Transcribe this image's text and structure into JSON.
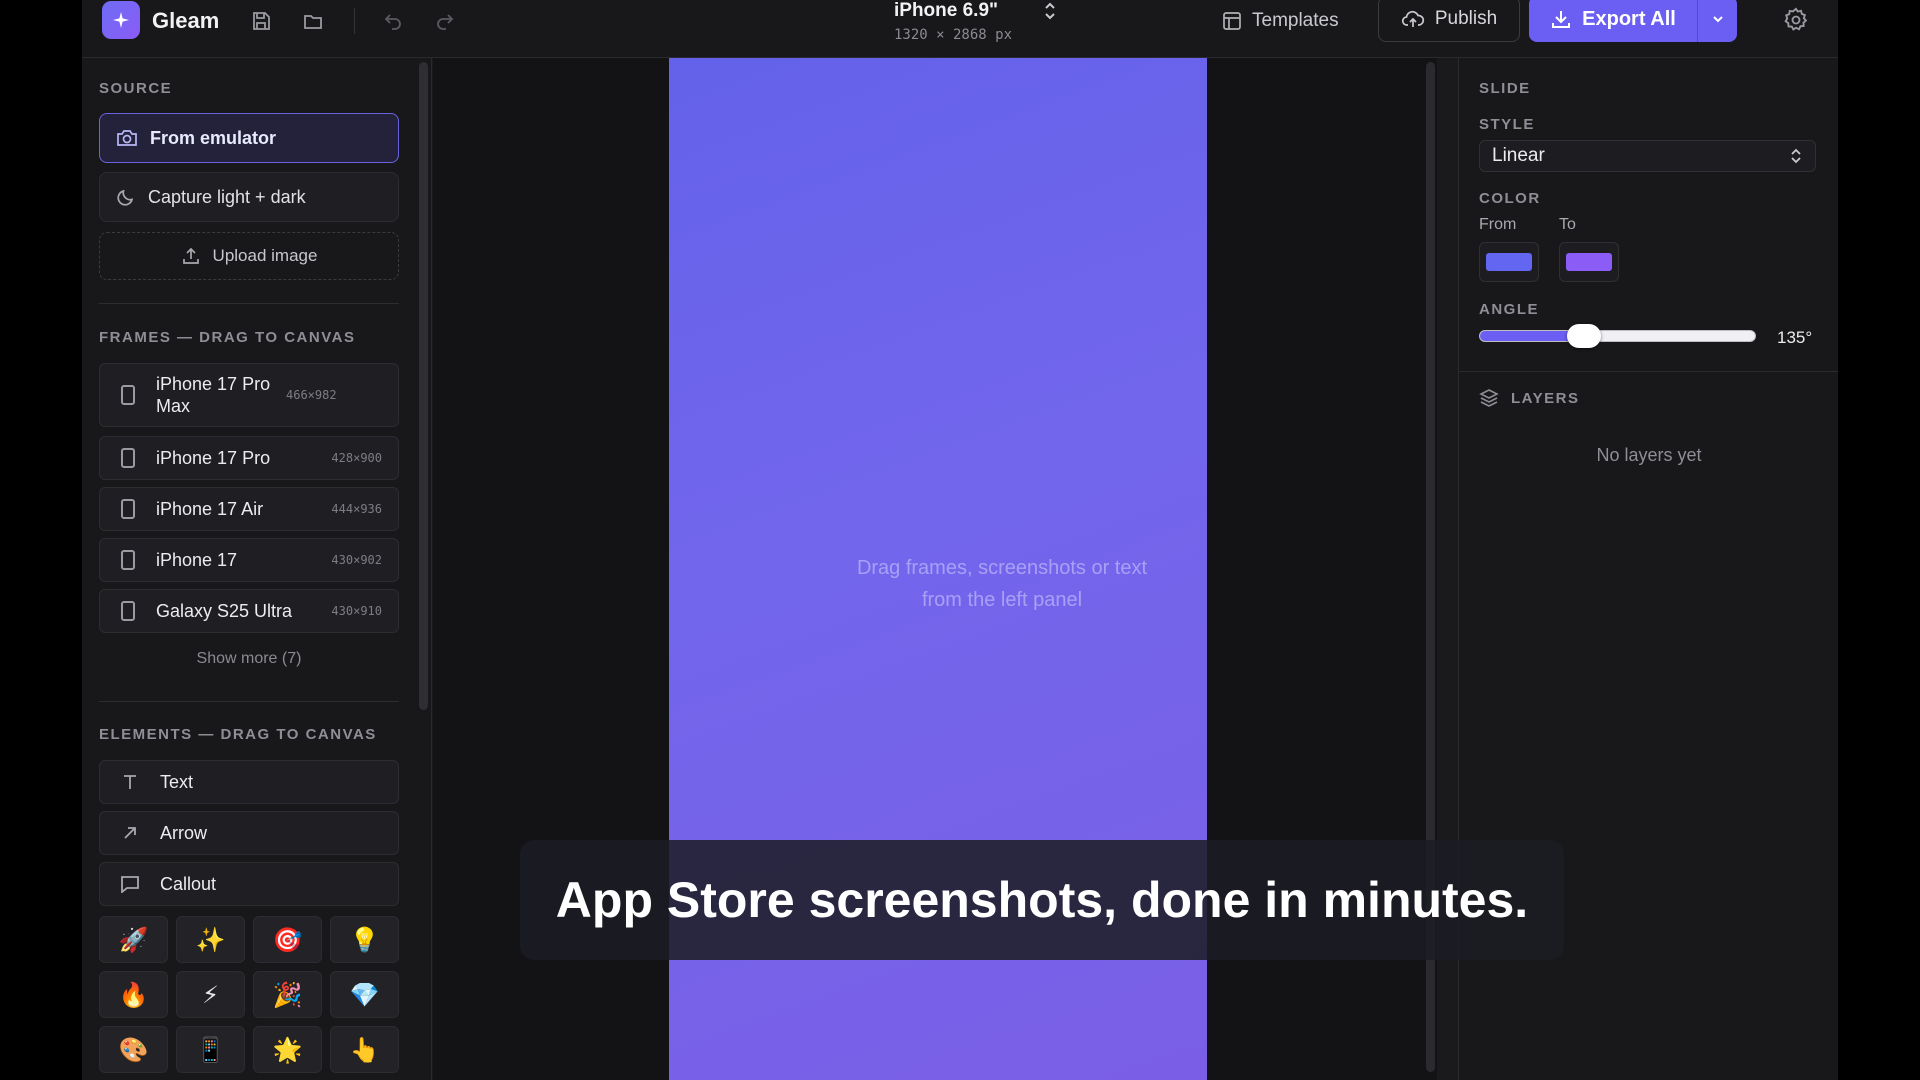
{
  "app": {
    "name": "Gleam"
  },
  "toolbar": {
    "device_title": "iPhone 6.9\"",
    "device_size": "1320 × 2868 px",
    "templates_label": "Templates",
    "publish_label": "Publish",
    "export_label": "Export All"
  },
  "left": {
    "source_label": "SOURCE",
    "sources": [
      {
        "label": "From emulator",
        "icon": "camera-icon",
        "active": true
      },
      {
        "label": "Capture light + dark",
        "icon": "moon-icon",
        "active": false
      },
      {
        "label": "Upload image",
        "icon": "upload-icon",
        "active": false
      }
    ],
    "frames_label": "FRAMES — DRAG TO CANVAS",
    "frames": [
      {
        "name": "iPhone 17 Pro Max",
        "dims": "466×982"
      },
      {
        "name": "iPhone 17 Pro",
        "dims": "428×900"
      },
      {
        "name": "iPhone 17 Air",
        "dims": "444×936"
      },
      {
        "name": "iPhone 17",
        "dims": "430×902"
      },
      {
        "name": "Galaxy S25 Ultra",
        "dims": "430×910"
      }
    ],
    "show_more": "Show more (7)",
    "elements_label": "ELEMENTS — DRAG TO CANVAS",
    "elements": [
      {
        "name": "Text",
        "icon": "text-icon"
      },
      {
        "name": "Arrow",
        "icon": "arrow-icon"
      },
      {
        "name": "Callout",
        "icon": "callout-icon"
      }
    ],
    "emojis": [
      "🚀",
      "✨",
      "🎯",
      "💡",
      "🔥",
      "⚡",
      "🎉",
      "💎",
      "🎨",
      "📱",
      "🌟",
      "👆"
    ]
  },
  "canvas": {
    "hint_line1": "Drag frames, screenshots or text",
    "hint_line2": "from the left panel",
    "caption": "App Store screenshots, done in minutes."
  },
  "right": {
    "slide_label": "SLIDE",
    "style_label": "STYLE",
    "style_value": "Linear",
    "color_label": "COLOR",
    "from_label": "From",
    "to_label": "To",
    "from_color": "#6366f1",
    "to_color": "#8b5cf6",
    "angle_label": "ANGLE",
    "angle_value": "135°",
    "angle_fraction": 0.375,
    "layers_label": "LAYERS",
    "no_layers": "No layers yet"
  },
  "colors": {
    "accent": "#6a5ff2",
    "background": "#18181b"
  }
}
